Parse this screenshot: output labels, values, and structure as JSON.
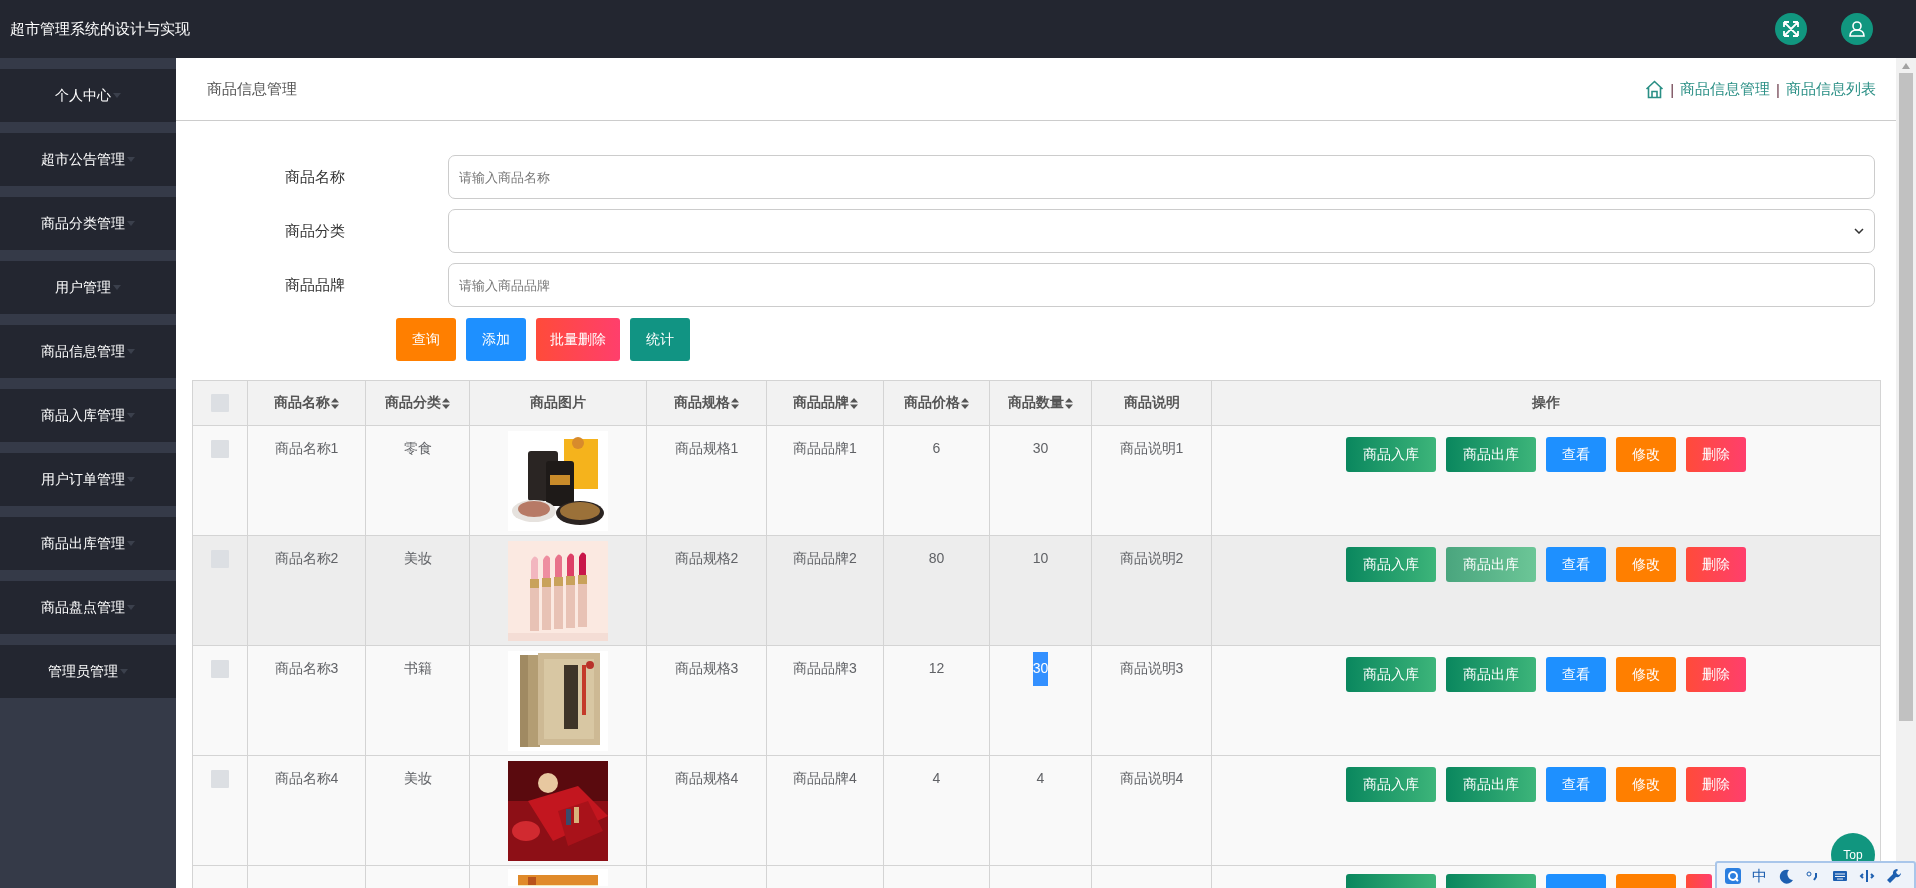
{
  "app_title": "超市管理系统的设计与实现",
  "sidebar": {
    "items": [
      {
        "label": "个人中心"
      },
      {
        "label": "超市公告管理"
      },
      {
        "label": "商品分类管理"
      },
      {
        "label": "用户管理"
      },
      {
        "label": "商品信息管理"
      },
      {
        "label": "商品入库管理"
      },
      {
        "label": "用户订单管理"
      },
      {
        "label": "商品出库管理"
      },
      {
        "label": "商品盘点管理"
      },
      {
        "label": "管理员管理"
      }
    ]
  },
  "page_title": "商品信息管理",
  "breadcrumb": [
    {
      "kind": "home"
    },
    {
      "kind": "separator",
      "text": "|"
    },
    {
      "kind": "link",
      "text": "商品信息管理"
    },
    {
      "kind": "separator",
      "text": "|"
    },
    {
      "kind": "link",
      "text": "商品信息列表"
    }
  ],
  "filters": [
    {
      "label": "商品名称",
      "kind": "text",
      "placeholder": "请输入商品名称"
    },
    {
      "label": "商品分类",
      "kind": "select"
    },
    {
      "label": "商品品牌",
      "kind": "text",
      "placeholder": "请输入商品品牌"
    }
  ],
  "buttons": [
    {
      "label": "查询",
      "kind": "query"
    },
    {
      "label": "添加",
      "kind": "add"
    },
    {
      "label": "批量删除",
      "kind": "batch-delete"
    },
    {
      "label": "统计",
      "kind": "stats"
    }
  ],
  "table": {
    "header_checked": false,
    "columns": [
      {
        "label": "商品名称",
        "sortable": true
      },
      {
        "label": "商品分类",
        "sortable": true
      },
      {
        "label": "商品图片",
        "sortable": false
      },
      {
        "label": "商品规格",
        "sortable": true
      },
      {
        "label": "商品品牌",
        "sortable": true
      },
      {
        "label": "商品价格",
        "sortable": true
      },
      {
        "label": "商品数量",
        "sortable": true
      },
      {
        "label": "商品说明",
        "sortable": false
      },
      {
        "label": "操作",
        "sortable": false
      }
    ],
    "rows": [
      {
        "checked": false,
        "hovered": false,
        "quantity_selected": false,
        "cells": [
          "商品名称1",
          "零食",
          {
            "kind": "picture"
          },
          "商品规格1",
          "商品品牌1",
          "6",
          "30",
          "商品说明1"
        ],
        "actions": [
          {
            "label": "商品入库",
            "kind": "stock-in",
            "hovered": false
          },
          {
            "label": "商品出库",
            "kind": "stock-out",
            "hovered": false
          },
          {
            "label": "查看",
            "kind": "view",
            "hovered": false
          },
          {
            "label": "修改",
            "kind": "edit",
            "hovered": false
          },
          {
            "label": "删除",
            "kind": "delete",
            "hovered": false
          }
        ]
      },
      {
        "checked": false,
        "hovered": true,
        "quantity_selected": false,
        "cells": [
          "商品名称2",
          "美妆",
          {
            "kind": "picture"
          },
          "商品规格2",
          "商品品牌2",
          "80",
          "10",
          "商品说明2"
        ],
        "actions": [
          {
            "label": "商品入库",
            "kind": "stock-in",
            "hovered": false
          },
          {
            "label": "商品出库",
            "kind": "stock-out",
            "hovered": true
          },
          {
            "label": "查看",
            "kind": "view",
            "hovered": false
          },
          {
            "label": "修改",
            "kind": "edit",
            "hovered": false
          },
          {
            "label": "删除",
            "kind": "delete",
            "hovered": false
          }
        ]
      },
      {
        "checked": false,
        "hovered": false,
        "quantity_selected": true,
        "cells": [
          "商品名称3",
          "书籍",
          {
            "kind": "picture"
          },
          "商品规格3",
          "商品品牌3",
          "12",
          "30",
          "商品说明3"
        ],
        "actions": [
          {
            "label": "商品入库",
            "kind": "stock-in",
            "hovered": false
          },
          {
            "label": "商品出库",
            "kind": "stock-out",
            "hovered": false
          },
          {
            "label": "查看",
            "kind": "view",
            "hovered": false
          },
          {
            "label": "修改",
            "kind": "edit",
            "hovered": false
          },
          {
            "label": "删除",
            "kind": "delete",
            "hovered": false
          }
        ]
      },
      {
        "checked": false,
        "hovered": false,
        "quantity_selected": false,
        "cells": [
          "商品名称4",
          "美妆",
          {
            "kind": "picture"
          },
          "商品规格4",
          "商品品牌4",
          "4",
          "4",
          "商品说明4"
        ],
        "actions": [
          {
            "label": "商品入库",
            "kind": "stock-in",
            "hovered": false
          },
          {
            "label": "商品出库",
            "kind": "stock-out",
            "hovered": false
          },
          {
            "label": "查看",
            "kind": "view",
            "hovered": false
          },
          {
            "label": "修改",
            "kind": "edit",
            "hovered": false
          },
          {
            "label": "删除",
            "kind": "delete",
            "hovered": false
          }
        ]
      }
    ],
    "cut_row": {
      "actions": [
        {
          "kind": "stock-in"
        },
        {
          "kind": "stock-out"
        },
        {
          "kind": "view"
        },
        {
          "kind": "edit"
        },
        {
          "kind": "delete"
        }
      ]
    }
  },
  "back_to_top": "Top",
  "ime_toolbar": {
    "mode": "中"
  }
}
